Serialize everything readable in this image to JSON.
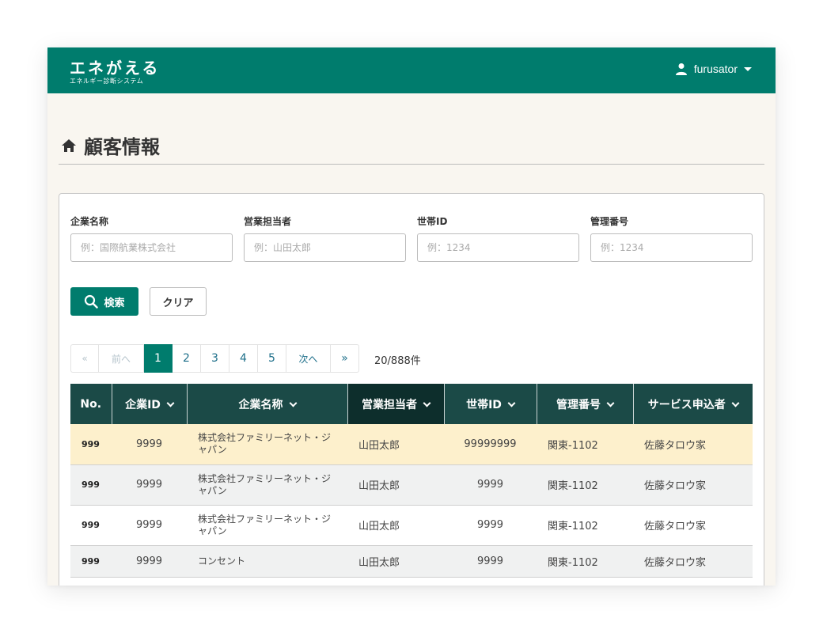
{
  "header": {
    "logo": "エネがえる",
    "logo_sub": "エネルギー診断システム",
    "username": "furusator"
  },
  "page": {
    "title": "顧客情報"
  },
  "search": {
    "fields": [
      {
        "label": "企業名称",
        "placeholder": "例：国際航業株式会社"
      },
      {
        "label": "営業担当者",
        "placeholder": "例：山田太郎"
      },
      {
        "label": "世帯ID",
        "placeholder": "例：1234"
      },
      {
        "label": "管理番号",
        "placeholder": "例：1234"
      }
    ],
    "search_button": "検索",
    "clear_button": "クリア"
  },
  "pagination": {
    "first": "«",
    "prev": "前へ",
    "pages": [
      "1",
      "2",
      "3",
      "4",
      "5"
    ],
    "current": "1",
    "next": "次へ",
    "last": "»",
    "count": "20/888件"
  },
  "table": {
    "columns": [
      "No.",
      "企業ID",
      "企業名称",
      "営業担当者",
      "世帯ID",
      "管理番号",
      "サービス申込者"
    ],
    "rows": [
      {
        "no": "999",
        "company_id": "9999",
        "company_name": "株式会社ファミリーネット・ジャパン",
        "sales_rep": "山田太郎",
        "household_id": "99999999",
        "mgmt_no": "関東-1102",
        "applicant": "佐藤タロウ家"
      },
      {
        "no": "999",
        "company_id": "9999",
        "company_name": "株式会社ファミリーネット・ジャパン",
        "sales_rep": "山田太郎",
        "household_id": "9999",
        "mgmt_no": "関東-1102",
        "applicant": "佐藤タロウ家"
      },
      {
        "no": "999",
        "company_id": "9999",
        "company_name": "株式会社ファミリーネット・ジャパン",
        "sales_rep": "山田太郎",
        "household_id": "9999",
        "mgmt_no": "関東-1102",
        "applicant": "佐藤タロウ家"
      },
      {
        "no": "999",
        "company_id": "9999",
        "company_name": "コンセント",
        "sales_rep": "山田太郎",
        "household_id": "9999",
        "mgmt_no": "関東-1102",
        "applicant": "佐藤タロウ家"
      }
    ]
  },
  "colors": {
    "brand": "#007c6d",
    "table_header": "#1b4a47",
    "row_highlight": "#fdf0cc"
  }
}
